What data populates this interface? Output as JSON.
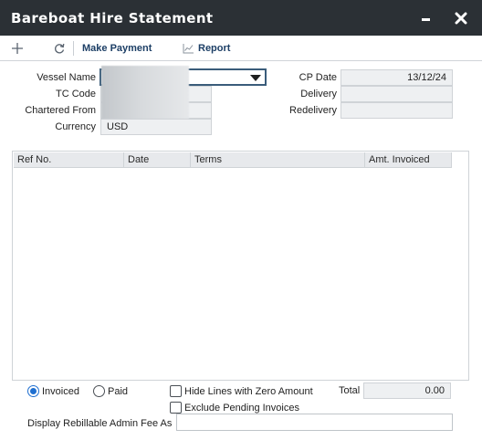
{
  "window": {
    "title": "Bareboat Hire Statement"
  },
  "toolbar": {
    "add_icon": "plus-icon",
    "refresh_icon": "refresh-icon",
    "make_payment_label": "Make Payment",
    "report_label": "Report",
    "report_icon": "line-chart-icon"
  },
  "form": {
    "vessel_name_label": "Vessel Name",
    "vessel_name_value": "",
    "tc_code_label": "TC Code",
    "tc_code_value": "",
    "chartered_from_label": "Chartered From",
    "chartered_from_value": "",
    "currency_label": "Currency",
    "currency_value": "USD",
    "cp_date_label": "CP Date",
    "cp_date_value": "13/12/24",
    "delivery_label": "Delivery",
    "delivery_value": "",
    "redelivery_label": "Redelivery",
    "redelivery_value": ""
  },
  "grid": {
    "columns": [
      "Ref No.",
      "Date",
      "Terms",
      "Amt. Invoiced"
    ],
    "rows": []
  },
  "footer": {
    "invoiced_label": "Invoiced",
    "paid_label": "Paid",
    "selected_filter": "Invoiced",
    "hide_zero_label": "Hide Lines with Zero Amount",
    "hide_zero_checked": false,
    "exclude_pending_label": "Exclude Pending Invoices",
    "exclude_pending_checked": false,
    "total_label": "Total",
    "total_value": "0.00",
    "admin_fee_label": "Display Rebillable Admin Fee As",
    "admin_fee_value": ""
  },
  "colors": {
    "titlebar": "#2b3035",
    "accent": "#1f6fd0",
    "link": "#1d3f66",
    "field_bg": "#eef0f2"
  }
}
